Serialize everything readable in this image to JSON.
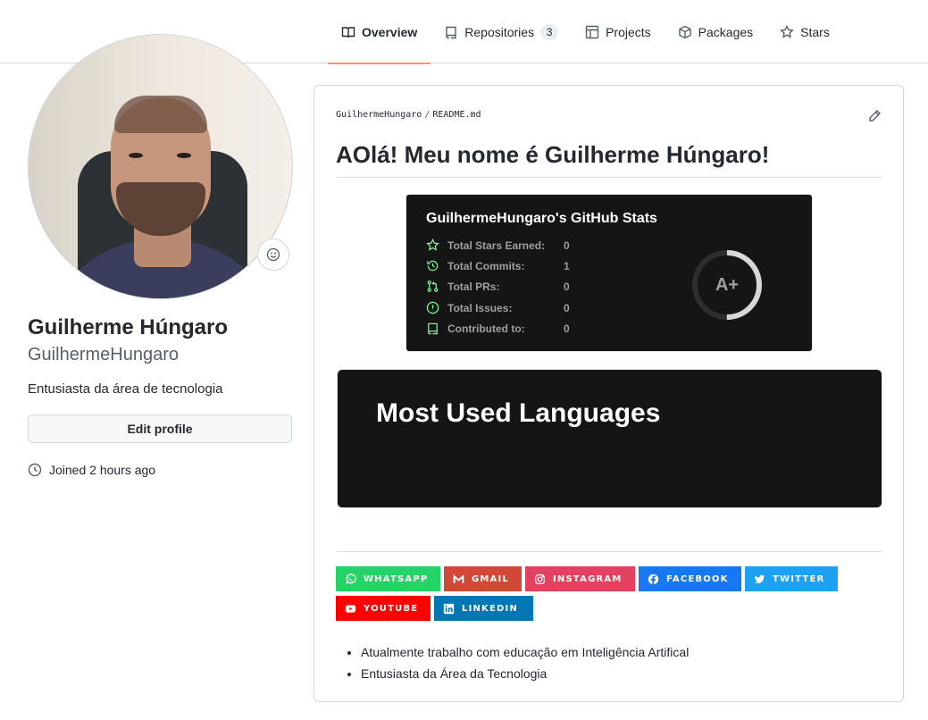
{
  "nav": {
    "tabs": [
      {
        "label": "Overview",
        "icon": "book-icon",
        "active": true
      },
      {
        "label": "Repositories",
        "icon": "repo-icon",
        "count": "3"
      },
      {
        "label": "Projects",
        "icon": "table-icon"
      },
      {
        "label": "Packages",
        "icon": "package-icon"
      },
      {
        "label": "Stars",
        "icon": "star-icon"
      }
    ]
  },
  "profile": {
    "name": "Guilherme Húngaro",
    "login": "GuilhermeHungaro",
    "bio": "Entusiasta da área de tecnologia",
    "edit_label": "Edit profile",
    "joined": "Joined 2 hours ago"
  },
  "readme": {
    "owner": "GuilhermeHungaro",
    "separator": "/",
    "file": "README.md",
    "heading": "AOlá! Meu nome é Guilherme Húngaro!",
    "stats": {
      "title": "GuilhermeHungaro's GitHub Stats",
      "rows": [
        {
          "label": "Total Stars Earned:",
          "value": "0",
          "icon": "star-icon"
        },
        {
          "label": "Total Commits:",
          "value": "1",
          "icon": "history-icon"
        },
        {
          "label": "Total PRs:",
          "value": "0",
          "icon": "pull-request-icon"
        },
        {
          "label": "Total Issues:",
          "value": "0",
          "icon": "issue-icon"
        },
        {
          "label": "Contributed to:",
          "value": "0",
          "icon": "repo-icon"
        }
      ],
      "rank": "A+",
      "rank_progress": 0.5
    },
    "languages_title": "Most Used Languages",
    "badges": [
      {
        "label": "WHATSAPP",
        "color": "#25D366",
        "icon": "whatsapp-icon"
      },
      {
        "label": "GMAIL",
        "color": "#D14836",
        "icon": "gmail-icon"
      },
      {
        "label": "INSTAGRAM",
        "color": "#E4405F",
        "icon": "instagram-icon"
      },
      {
        "label": "FACEBOOK",
        "color": "#1877F2",
        "icon": "facebook-icon"
      },
      {
        "label": "TWITTER",
        "color": "#1DA1F2",
        "icon": "twitter-icon"
      },
      {
        "label": "YOUTUBE",
        "color": "#FF0000",
        "icon": "youtube-icon"
      },
      {
        "label": "LINKEDIN",
        "color": "#0077B5",
        "icon": "linkedin-icon"
      }
    ],
    "bullets": [
      "Atualmente trabalho com educação em Inteligência Artifical",
      "Entusiasta da Área da Tecnologia"
    ]
  },
  "colors": {
    "accent_underline": "#fd8c73",
    "stats_icon": "#79ff97",
    "card_bg": "#151515"
  }
}
